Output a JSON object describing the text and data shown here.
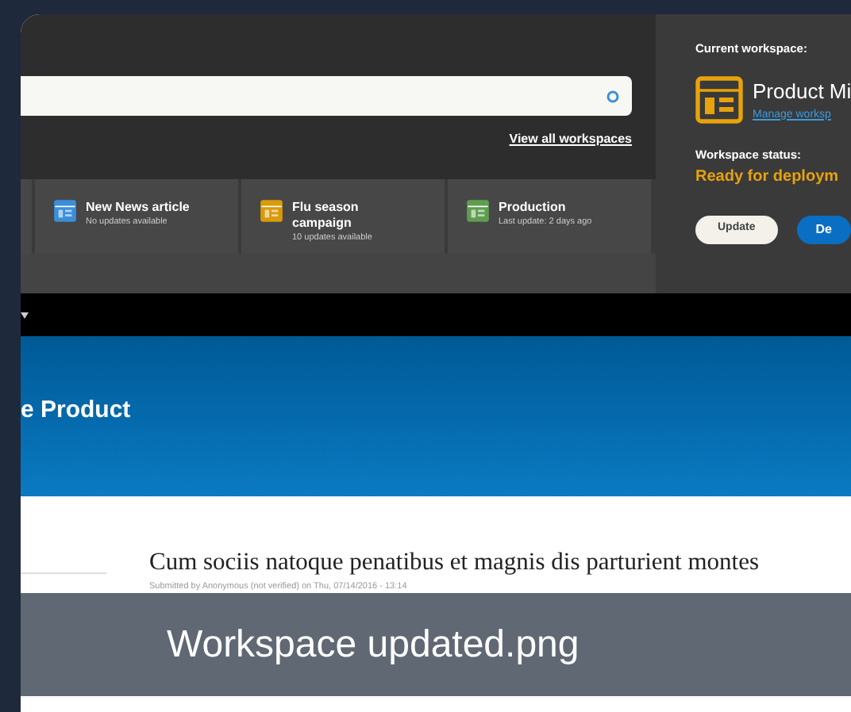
{
  "preview": {
    "filename": "Workspace updated.png"
  },
  "workspace_switcher": {
    "view_all_link": "View all workspaces",
    "workspaces": [
      {
        "name": "New News article",
        "status": "No updates available",
        "color": "#3b8fd9"
      },
      {
        "name": "Flu season campaign",
        "status": "10 updates available",
        "color": "#d99a0b"
      },
      {
        "name": "Production",
        "status": "Last update: 2 days ago",
        "color": "#5f9e4f"
      }
    ]
  },
  "current_workspace": {
    "label": "Current workspace:",
    "name": "Product Mi",
    "manage_link": "Manage worksp",
    "status_label": "Workspace status:",
    "status": "Ready for deploym",
    "buttons": [
      {
        "label": "Update",
        "kind": "secondary"
      },
      {
        "label": "De",
        "kind": "primary"
      }
    ]
  },
  "site": {
    "title": "e Product",
    "article_title": "Cum sociis natoque penatibus et magnis dis parturient montes",
    "byline": "Submitted by Anonymous (not verified) on Thu, 07/14/2016 - 13:14"
  }
}
